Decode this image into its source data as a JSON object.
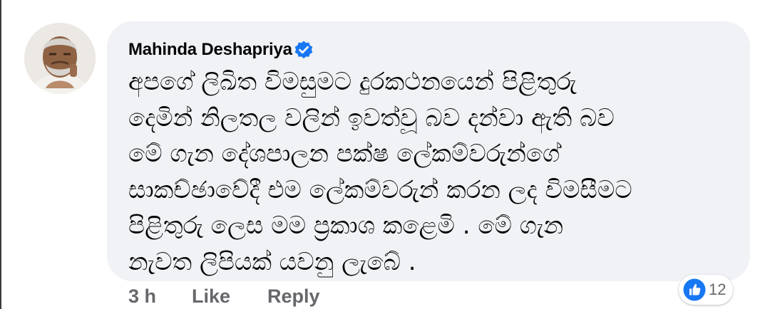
{
  "comment": {
    "author": "Mahinda Deshapriya",
    "verified": true,
    "lines": [
      "අපගේ ලිඛිත විමසුමට  දුරකථනයෙන් පිළිතුරු",
      "දෙමින්  නිලතල වලින් ඉවත්වූ බව දන්වා ඇති බව",
      "මේ ගැන දේශපාලන  පක්ෂ  ලේකම්වරුන්ගේ",
      "සාකච්ඡාවේදී එම ලේකම්වරුන්  කරන ලද විමසීමට",
      "පිළිතුරු  ලෙස  මම  ප්‍රකාශ  කළෙමි .  මේ ගැන",
      "නැවත ලිපියක් යවනු ලැබේ ."
    ]
  },
  "actions": {
    "time": "3 h",
    "like": "Like",
    "reply": "Reply"
  },
  "reactions": {
    "icon": "like-thumbs-up-icon",
    "count": "12"
  },
  "colors": {
    "bubble": "#f0f2f5",
    "text": "#050505",
    "muted": "#65676b",
    "brand_blue": "#1877f2"
  }
}
